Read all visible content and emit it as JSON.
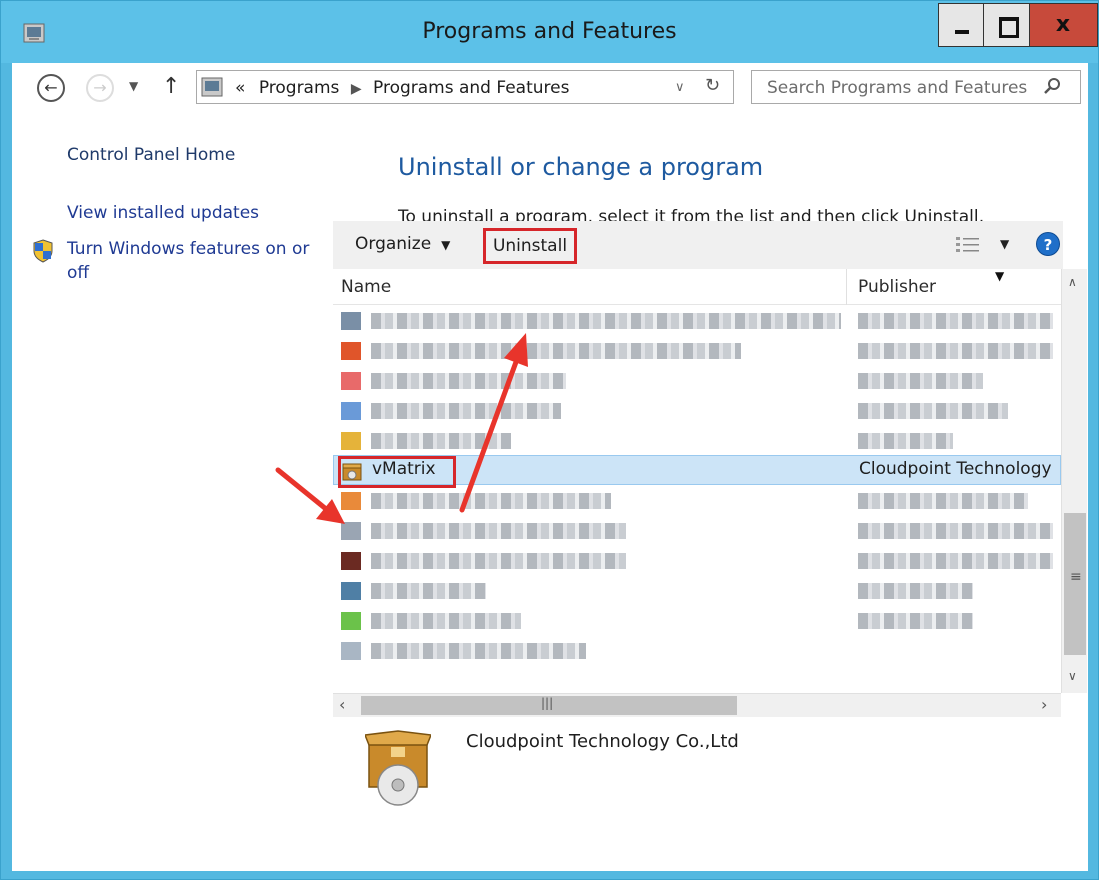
{
  "window": {
    "title": "Programs and Features"
  },
  "address": {
    "separator": "«",
    "crumbs": [
      "Programs",
      "Programs and Features"
    ],
    "search_placeholder": "Search Programs and Features"
  },
  "left_pane": {
    "home": "Control Panel Home",
    "updates": "View installed updates",
    "features": "Turn Windows features on or off"
  },
  "main": {
    "heading": "Uninstall or change a program",
    "instructions": "To uninstall a program, select it from the list and then click Uninstall, Change, or Repair."
  },
  "toolbar": {
    "organize": "Organize",
    "uninstall": "Uninstall"
  },
  "columns": {
    "name": "Name",
    "publisher": "Publisher"
  },
  "selected_row": {
    "name": "vMatrix",
    "publisher": "Cloudpoint Technology"
  },
  "details": {
    "publisher": "Cloudpoint Technology Co.,Ltd"
  },
  "colors": {
    "highlight": "#d6262a",
    "selection": "#cce4f7",
    "titlebar": "#5cc1e8",
    "link": "#1f3a93"
  }
}
